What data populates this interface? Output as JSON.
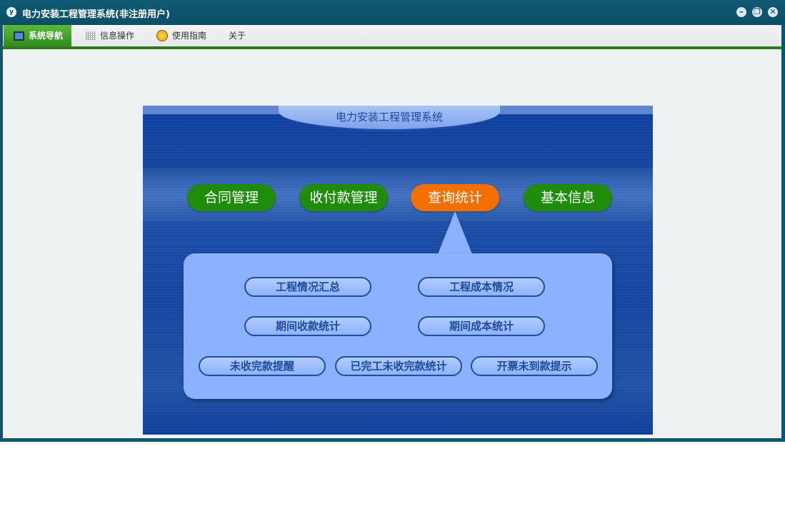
{
  "window": {
    "title": "电力安装工程管理系统(非注册用户)",
    "app_icon_glyph": "y"
  },
  "window_controls": {
    "minimize_glyph": "–",
    "restore_glyph": "❐",
    "close_glyph": "✕"
  },
  "menu": {
    "items": [
      {
        "label": "系统导航",
        "icon": "monitor-icon",
        "active": true
      },
      {
        "label": "信息操作",
        "icon": "grid-icon"
      },
      {
        "label": "使用指南",
        "icon": "help-icon"
      },
      {
        "label": "关于"
      }
    ]
  },
  "panel": {
    "title": "电力安装工程管理系统",
    "nav": [
      "合同管理",
      "收付款管理",
      "查询统计",
      "基本信息"
    ],
    "active_nav": "查询统计",
    "sub_buttons": [
      "工程情况汇总",
      "工程成本情况",
      "期间收款统计",
      "期间成本统计",
      "未收完款提醒",
      "已完工未收完款统计",
      "开票未到款提示"
    ]
  },
  "colors": {
    "title_bar": "#0b4f66",
    "menu_active": "#2f8e1b",
    "nav_pill": "#1f8c0c",
    "nav_pill_active": "#f26f00",
    "callout": "#8cb1ff",
    "sub_button_text": "#1d4ba0"
  }
}
